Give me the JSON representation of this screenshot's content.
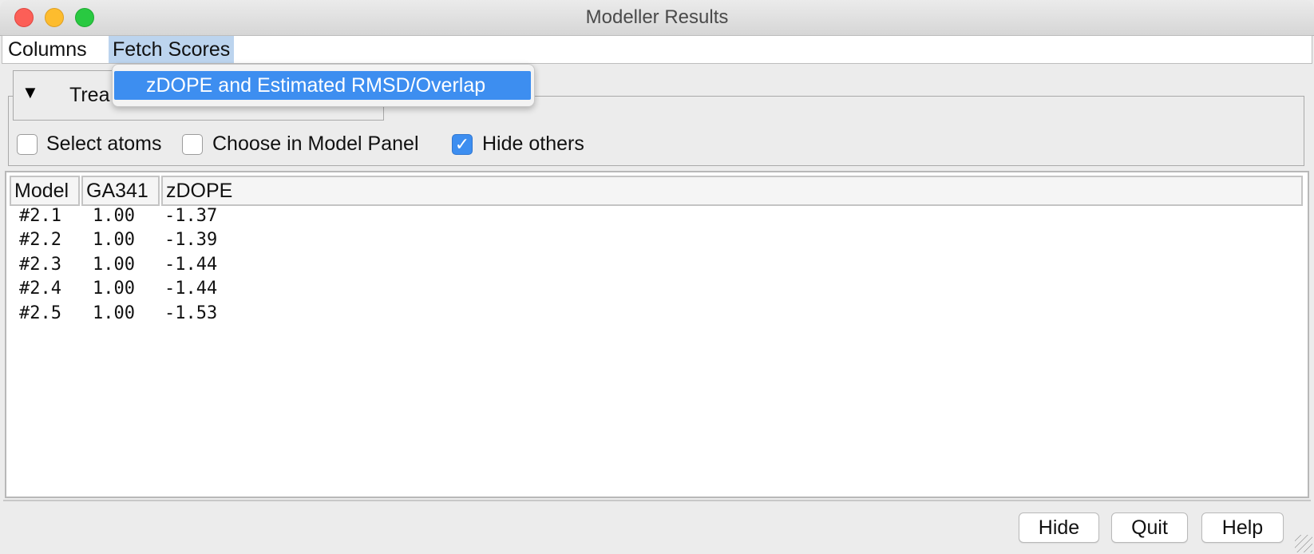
{
  "window": {
    "title": "Modeller Results"
  },
  "menubar": {
    "items": [
      "Columns",
      "Fetch Scores"
    ],
    "open_menu": "Fetch Scores",
    "dropdown_items": [
      "zDOPE and Estimated RMSD/Overlap"
    ]
  },
  "treatment": {
    "label": "Trea",
    "expanded_icon": "triangle-down-icon"
  },
  "options": [
    {
      "label": "Select atoms",
      "checked": false
    },
    {
      "label": "Choose in Model Panel",
      "checked": false
    },
    {
      "label": "Hide others",
      "checked": true
    }
  ],
  "table": {
    "columns": [
      "Model",
      "GA341",
      "zDOPE"
    ],
    "rows": [
      [
        "#2.1",
        "1.00",
        "-1.37"
      ],
      [
        "#2.2",
        "1.00",
        "-1.39"
      ],
      [
        "#2.3",
        "1.00",
        "-1.44"
      ],
      [
        "#2.4",
        "1.00",
        "-1.44"
      ],
      [
        "#2.5",
        "1.00",
        "-1.53"
      ]
    ]
  },
  "buttons": [
    "Hide",
    "Quit",
    "Help"
  ],
  "colors": {
    "selection": "#3d8ef0",
    "menu_highlight": "#bcd4ee"
  }
}
